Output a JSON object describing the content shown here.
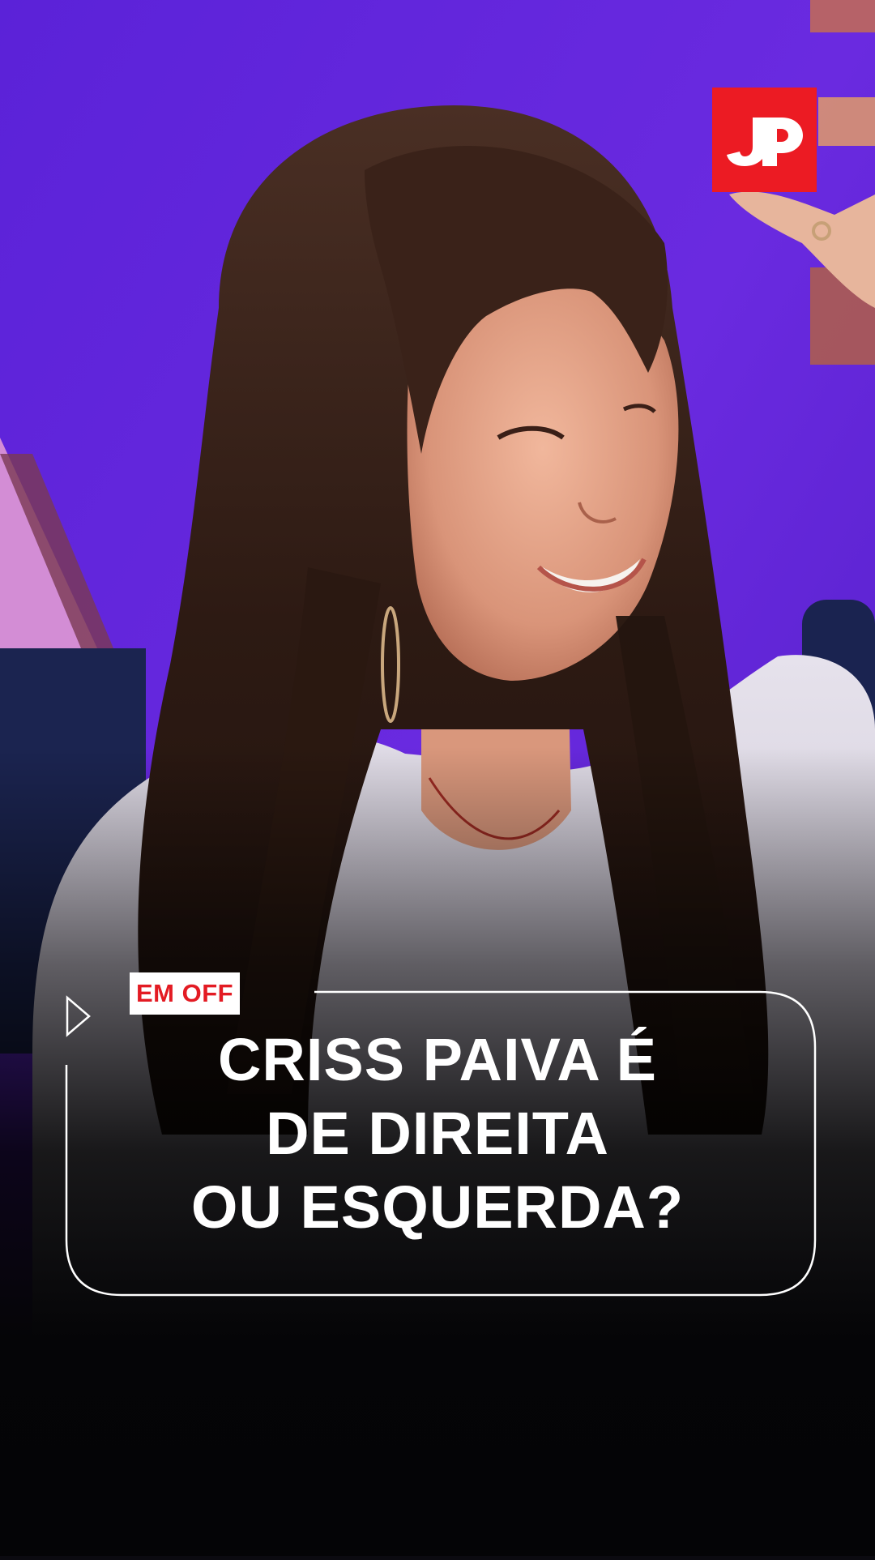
{
  "brand": {
    "logo_text": "JP",
    "logo_color": "#ec1b23"
  },
  "caption": {
    "tag": "EM OFF",
    "tag_color": "#e31b23",
    "headline_lines": [
      "CRISS PAIVA É",
      "DE DIREITA",
      "OU ESQUERDA?"
    ]
  },
  "photo": {
    "icon": "play-icon",
    "background_color": "#5a1fd0"
  }
}
